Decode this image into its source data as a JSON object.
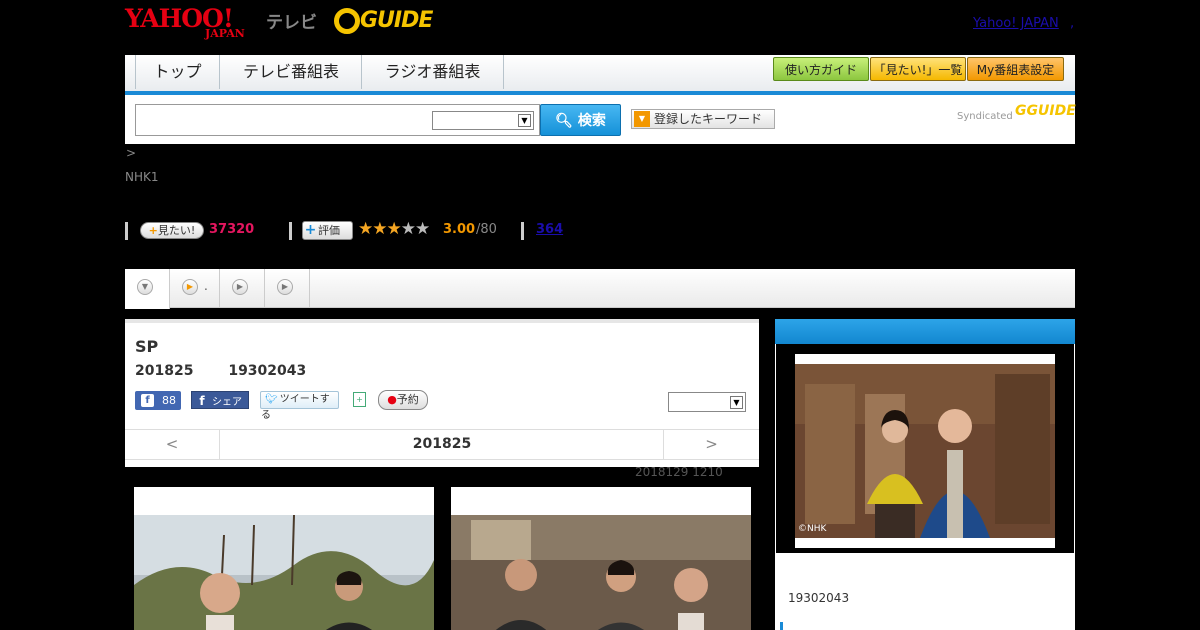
{
  "header": {
    "yahoo_logo": "YAHOO!",
    "yahoo_sub": "JAPAN",
    "tv_label": "テレビ",
    "gguide_logo": "GUIDE",
    "yahoo_japan_link": "Yahoo! JAPAN",
    "yahoo_link_dot": ","
  },
  "nav": {
    "tabs": [
      "トップ",
      "テレビ番組表",
      "ラジオ番組表"
    ],
    "buttons": [
      "使い方ガイド",
      "「見たい!」一覧",
      "My番組表設定"
    ]
  },
  "search": {
    "button_label": "検索",
    "keyword_button": "登録したキーワード",
    "syndicated": "Syndicated",
    "syn_logo": "GUIDE"
  },
  "breadcrumb": ">",
  "channel": "NHK1",
  "stats": {
    "mitai_label": "見たい!",
    "mitai_count": "37320",
    "hyoka_label": "評価",
    "stars_filled": 3,
    "stars_total": 5,
    "rating": "3.00",
    "rating_den": "/80",
    "reviews": "364"
  },
  "tabs": {
    "second_tab_text": "."
  },
  "program": {
    "title": "SP",
    "date_meta": "201825",
    "time_meta": "19302043",
    "fb_like_count": "88",
    "fb_share": "シェア",
    "tweet": "ツイートする",
    "reserve": "予約"
  },
  "datenav": {
    "prev": "<",
    "date": "201825",
    "next": ">"
  },
  "updated": "2018129  1210",
  "right_panel": {
    "photo_credit": "©NHK",
    "time_meta": "19302043"
  },
  "colors": {
    "accent_blue": "#1a8ad6",
    "mitai_pink": "#e4165f",
    "rating_orange": "#f39800"
  }
}
